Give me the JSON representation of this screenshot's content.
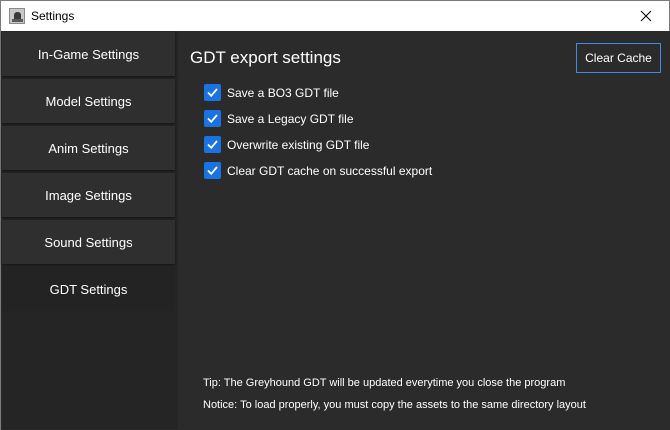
{
  "window": {
    "title": "Settings",
    "icon": "greyhound-app-icon",
    "close_icon": "close-icon"
  },
  "sidebar": {
    "items": [
      {
        "label": "In-Game Settings",
        "active": false
      },
      {
        "label": "Model Settings",
        "active": false
      },
      {
        "label": "Anim Settings",
        "active": false
      },
      {
        "label": "Image Settings",
        "active": false
      },
      {
        "label": "Sound Settings",
        "active": false
      },
      {
        "label": "GDT Settings",
        "active": true
      }
    ]
  },
  "main": {
    "title": "GDT export settings",
    "clear_cache_label": "Clear Cache",
    "options": [
      {
        "label": "Save a BO3 GDT file",
        "checked": true
      },
      {
        "label": "Save a Legacy GDT file",
        "checked": true
      },
      {
        "label": "Overwrite existing GDT file",
        "checked": true
      },
      {
        "label": "Clear GDT cache on successful export",
        "checked": true
      }
    ],
    "tip": "Tip: The Greyhound GDT will be updated everytime you close the program",
    "notice": "Notice: To load properly, you must copy the assets to the same directory layout"
  },
  "colors": {
    "background": "#2b2b2b",
    "accent": "#1a73e0",
    "button_border": "#3c8ee0"
  }
}
